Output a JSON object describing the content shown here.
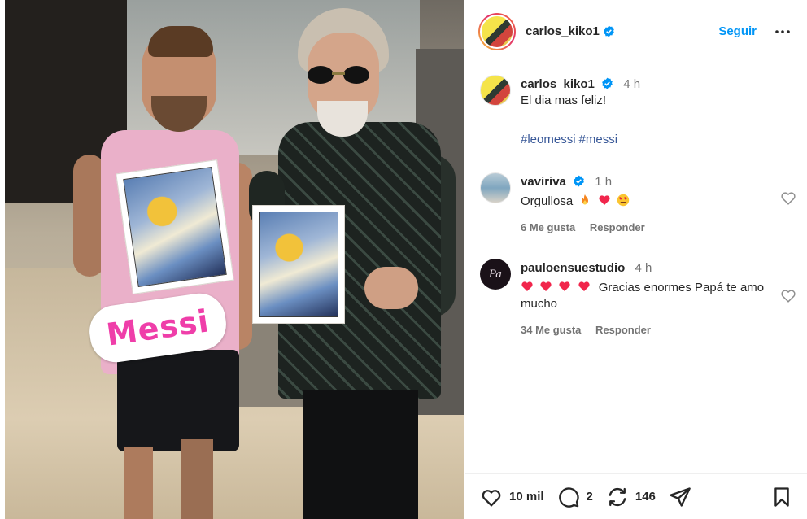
{
  "post": {
    "username": "carlos_kiko1",
    "follow_label": "Seguir",
    "time": "4 h",
    "caption": "El dia mas feliz!",
    "hashtags": [
      "#leomessi",
      "#messi"
    ],
    "photo_sticker_text": "Messi"
  },
  "comments": [
    {
      "username": "vaviriva",
      "time": "1 h",
      "text": "Orgullosa",
      "emojis": [
        "fire-emoji",
        "red-heart-emoji",
        "heart-eyes-emoji"
      ],
      "likes_label": "6 Me gusta",
      "reply_label": "Responder"
    },
    {
      "username": "pauloensuestudio",
      "time": "4 h",
      "emojis": [
        "red-heart-emoji",
        "red-heart-emoji",
        "red-heart-emoji",
        "red-heart-emoji"
      ],
      "text": "Gracias enormes Papá te amo mucho",
      "likes_label": "34 Me gusta",
      "reply_label": "Responder"
    }
  ],
  "actions": {
    "likes": "10 mil",
    "comments": "2",
    "reposts": "146"
  },
  "colors": {
    "accent": "#0095f6",
    "verified": "#0095f6",
    "sticker_pink": "#ef3ea9",
    "hashtag": "#385898"
  }
}
